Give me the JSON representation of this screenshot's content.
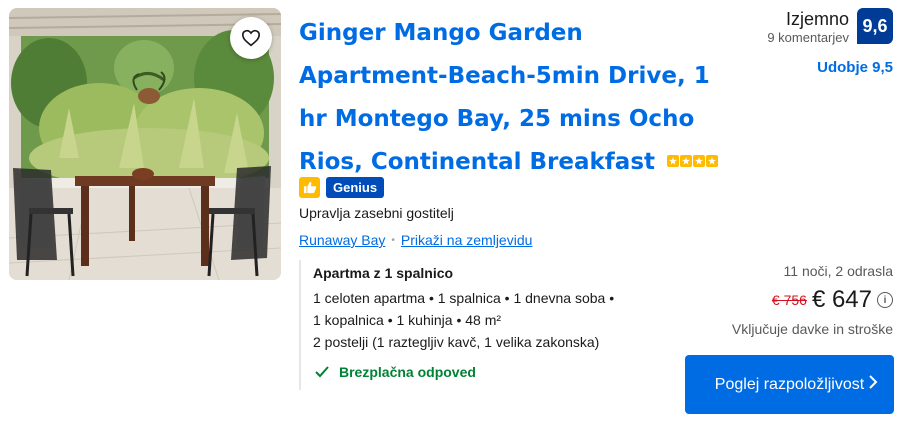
{
  "property": {
    "title": "Ginger Mango Garden Apartment-Beach-5min Drive, 1 hr Montego Bay, 25 mins Ocho Rios, Continental Breakfast",
    "star_count": 4,
    "genius_label": "Genius",
    "host": "Upravlja zasebni gostitelj",
    "location_link": "Runaway Bay",
    "map_link": "Prikaži na zemljevidu"
  },
  "review": {
    "word": "Izjemno",
    "count": "9 komentarjev",
    "score": "9,6",
    "location_score": "Udobje 9,5"
  },
  "room": {
    "title": "Apartma z 1 spalnico",
    "lines": [
      "1 celoten apartma • 1 spalnica • 1 dnevna soba •",
      "1 kopalnica • 1 kuhinja • 48 m²",
      "2 postelji (1 raztegljiv kavč, 1 velika zakonska)"
    ],
    "cancellation": "Brezplačna odpoved"
  },
  "pricing": {
    "stay": "11 noči, 2 odrasla",
    "old_price": "€ 756",
    "new_price": "€ 647",
    "taxes": "Vključuje davke in stroške"
  },
  "cta": {
    "label": "Poglej razpoložljivost"
  },
  "colors": {
    "brand_blue": "#006ce4",
    "score_blue": "#003b95",
    "star_yellow": "#febb02",
    "genius_blue": "#004cb8",
    "discount_red": "#d4111e",
    "success_green": "#008234"
  },
  "icons": {
    "favorite": "heart-icon",
    "thumb": "thumbs-up-icon",
    "info": "info-icon",
    "check": "check-icon",
    "chevron": "chevron-right-icon"
  }
}
